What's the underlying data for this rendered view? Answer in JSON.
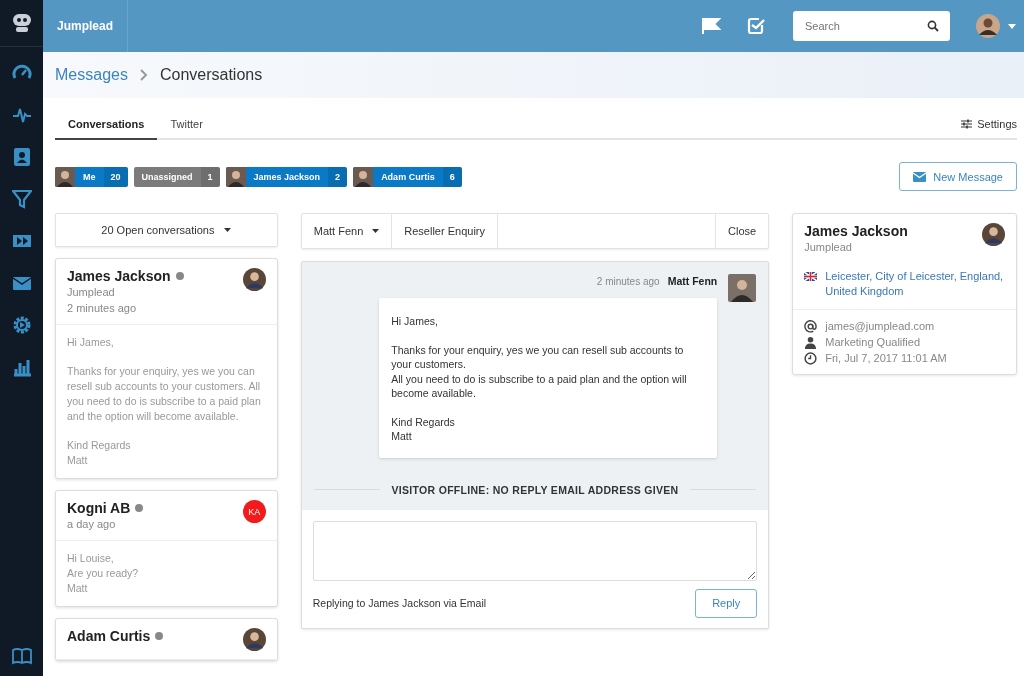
{
  "app": {
    "name": "Jumplead"
  },
  "sidebar": {
    "items": [
      {
        "kind": "gauge"
      },
      {
        "kind": "pulse"
      },
      {
        "kind": "contact"
      },
      {
        "kind": "filter"
      },
      {
        "kind": "forward"
      },
      {
        "kind": "mail"
      },
      {
        "kind": "gear"
      },
      {
        "kind": "chart"
      }
    ],
    "footer": {
      "kind": "book"
    }
  },
  "topbar": {
    "search": {
      "placeholder": "Search"
    }
  },
  "breadcrumb": [
    {
      "label": "Messages",
      "kind": "link"
    },
    {
      "label": "Conversations",
      "kind": "current"
    }
  ],
  "tabs": [
    {
      "label": "Conversations",
      "selected": true
    },
    {
      "label": "Twitter",
      "selected": false
    }
  ],
  "settings": {
    "label": "Settings"
  },
  "filters": [
    {
      "label": "Me",
      "count": "20",
      "kind": "user"
    },
    {
      "label": "Unassigned",
      "count": "1",
      "kind": "unassigned"
    },
    {
      "label": "James Jackson",
      "count": "2",
      "kind": "user"
    },
    {
      "label": "Adam Curtis",
      "count": "6",
      "kind": "user"
    }
  ],
  "new_message": {
    "label": "New Message"
  },
  "conversation_filter": {
    "label": "20 Open conversations"
  },
  "conversations": [
    {
      "name": "James Jackson",
      "company": "Jumplead",
      "time": "2 minutes ago",
      "avatar": {
        "kind": "photo"
      },
      "paragraphs": [
        "Hi James,",
        "Thanks for your enquiry, yes we you can resell sub accounts to your customers. All you need to do is subscribe to a paid plan and the option will become available.",
        "Kind Regards\nMatt"
      ]
    },
    {
      "name": "Kogni AB",
      "time": "a day ago",
      "avatar": {
        "kind": "initials",
        "text": "KA",
        "color": "#f21b1b"
      },
      "paragraphs": [
        "Hi Louise,\nAre you ready?\nMatt"
      ]
    },
    {
      "name": "Adam Curtis",
      "avatar": {
        "kind": "photo"
      }
    }
  ],
  "thread": {
    "assignee": "Matt Fenn",
    "subject": "Reseller Enquiry",
    "close": "Close",
    "messages": [
      {
        "time": "2 minutes ago",
        "author": "Matt Fenn",
        "paragraphs": [
          "Hi James,",
          "Thanks for your enquiry, yes we you can resell sub accounts to your customers.\nAll you need to do is subscribe to a paid plan and the option will become available.",
          "Kind Regards\nMatt"
        ]
      }
    ],
    "notice": "VISITOR OFFLINE: NO REPLY EMAIL ADDRESS GIVEN",
    "reply_hint": "Replying to James Jackson via Email",
    "reply_button": "Reply"
  },
  "contact": {
    "name": "James Jackson",
    "company": "Jumplead",
    "location": "Leicester, City of Leicester, England, United Kingdom",
    "details": [
      {
        "kind": "email",
        "text": "james@jumplead.com"
      },
      {
        "kind": "status",
        "text": "Marketing Qualified"
      },
      {
        "kind": "date",
        "text": "Fri, Jul 7, 2017 11:01 AM"
      }
    ]
  }
}
